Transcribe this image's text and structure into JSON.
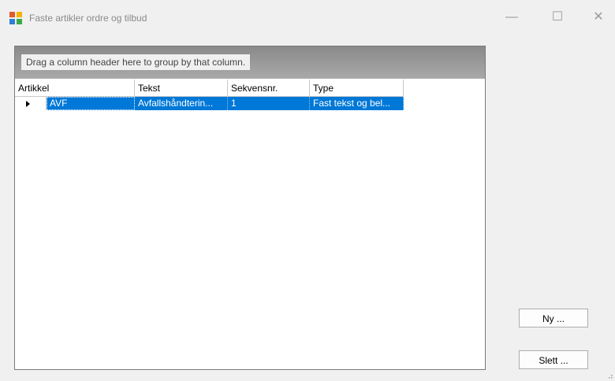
{
  "window": {
    "title": "Faste artikler ordre og tilbud",
    "minimize": "—",
    "maximize": "☐",
    "close": "✕"
  },
  "grid": {
    "group_hint": "Drag a column header here to group by that column.",
    "columns": [
      "Artikkel",
      "Tekst",
      "Sekvensnr.",
      "Type"
    ],
    "rows": [
      {
        "artikkel": "AVF",
        "tekst": "Avfallshåndterin...",
        "sekvensnr": "1",
        "type": "Fast tekst og bel..."
      }
    ]
  },
  "buttons": {
    "new_label": "Ny ...",
    "delete_label": "Slett ..."
  },
  "colors": {
    "selection": "#0078d7",
    "group_panel": "#9a9a9a",
    "window_bg": "#f0f0f0"
  },
  "icons": {
    "app": "app-window-icon",
    "row_indicator": "row-arrow-icon"
  }
}
